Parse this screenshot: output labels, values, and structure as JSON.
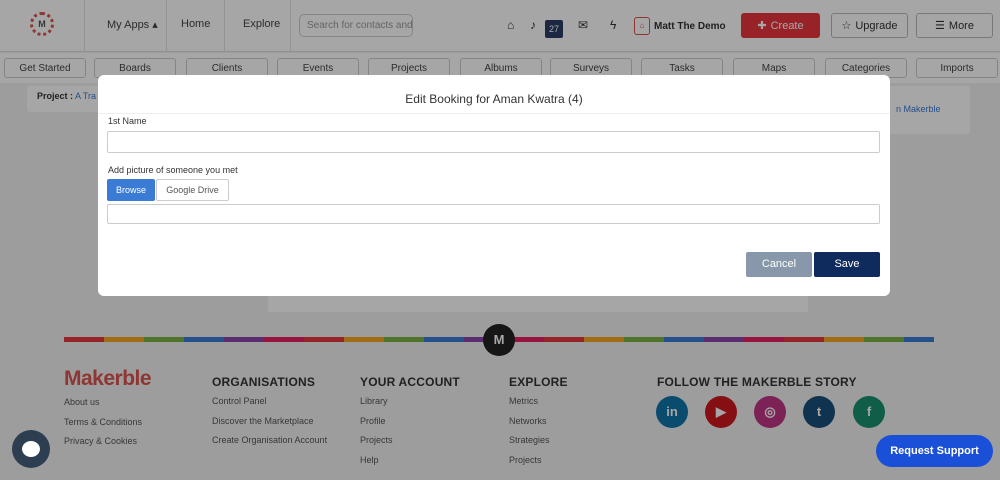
{
  "nav": {
    "my_apps": "My Apps ▴",
    "home": "Home",
    "explore": "Explore",
    "search_placeholder": "Search for contacts and",
    "notification_count": "27",
    "user_name": "Matt The Demo",
    "create_label": "Create",
    "upgrade_label": "Upgrade",
    "more_label": "More"
  },
  "tabs": [
    "Get Started",
    "Boards",
    "Clients",
    "Events",
    "Projects",
    "Albums",
    "Surveys",
    "Tasks",
    "Maps",
    "Categories",
    "Imports"
  ],
  "background": {
    "project_label": "Project :",
    "project_value": "A Tra",
    "side_link": "n Makerble"
  },
  "modal": {
    "title": "Edit Booking for Aman Kwatra (4)",
    "first_name_label": "1st Name",
    "first_name_value": "",
    "picture_label": "Add picture of someone you met",
    "browse_label": "Browse",
    "gdrive_label": "Google Drive",
    "file_value": "",
    "cancel_label": "Cancel",
    "save_label": "Save"
  },
  "footer": {
    "brand": "Makerble",
    "brand_links": [
      "About us",
      "Terms & Conditions",
      "Privacy & Cookies"
    ],
    "organisations": {
      "heading": "ORGANISATIONS",
      "links": [
        "Control Panel",
        "Discover the Marketplace",
        "Create Organisation Account"
      ]
    },
    "account": {
      "heading": "YOUR ACCOUNT",
      "links": [
        "Library",
        "Profile",
        "Projects",
        "Help"
      ]
    },
    "explore": {
      "heading": "EXPLORE",
      "links": [
        "Metrics",
        "Networks",
        "Strategies",
        "Projects"
      ]
    },
    "follow_heading": "FOLLOW THE MAKERBLE STORY",
    "social": [
      "in",
      "▶",
      "◎",
      "t",
      "f"
    ]
  },
  "m_circle": "M",
  "request_support": "Request Support",
  "colors": {
    "accent_red": "#e8363f",
    "primary_navy": "#0f2a5c",
    "browse_blue": "#3a7bd5",
    "support_blue": "#1a4fd8",
    "linkedin": "#0e76a8",
    "youtube": "#cc181e",
    "instagram": "#c13584",
    "twitter": "#1da1f2",
    "facebook": "#1a8f6f"
  }
}
